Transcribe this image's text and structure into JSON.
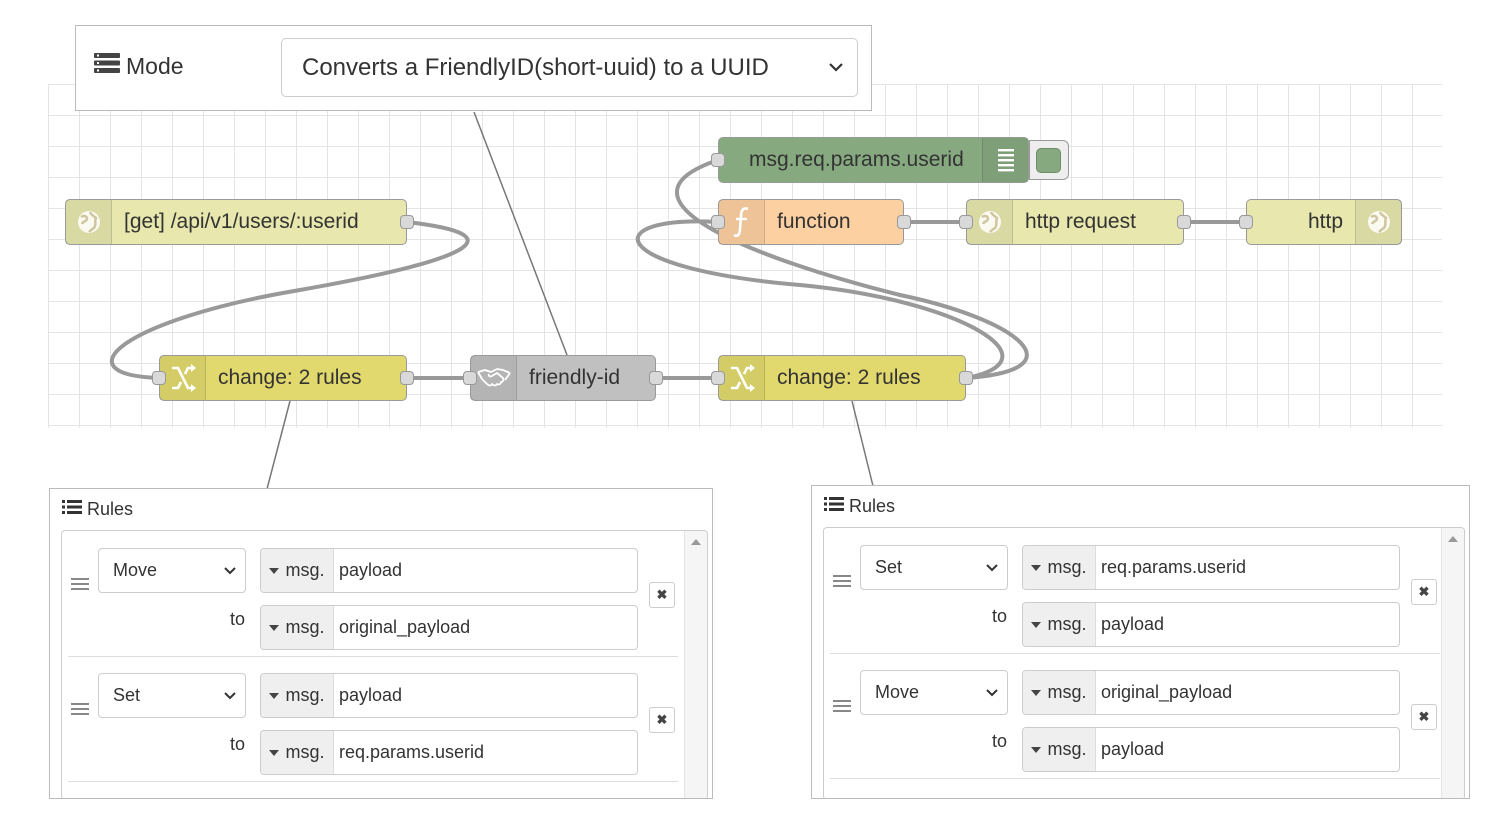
{
  "mode_panel": {
    "label": "Mode",
    "icon": "list-alt-icon",
    "selected": "Converts a FriendlyID(short-uuid) to a UUID"
  },
  "nodes": {
    "http_in": "[get] /api/v1/users/:userid",
    "debug": "msg.req.params.userid",
    "function": "function",
    "http_request": "http request",
    "http_response": "http",
    "change_left": "change: 2 rules",
    "friendly_id": "friendly-id",
    "change_right": "change: 2 rules"
  },
  "colors": {
    "http": "#e7e7ae",
    "debug": "#87a980",
    "function": "#fdd0a2",
    "change": "#e2d96e",
    "friendly": "#c0c0c0"
  },
  "rules_left": {
    "title": "Rules",
    "rules": [
      {
        "action": "Move",
        "from_type": "msg.",
        "from": "payload",
        "to_label": "to",
        "to_type": "msg.",
        "to": "original_payload"
      },
      {
        "action": "Set",
        "from_type": "msg.",
        "from": "payload",
        "to_label": "to",
        "to_type": "msg.",
        "to": "req.params.userid"
      }
    ]
  },
  "rules_right": {
    "title": "Rules",
    "rules": [
      {
        "action": "Set",
        "from_type": "msg.",
        "from": "req.params.userid",
        "to_label": "to",
        "to_type": "msg.",
        "to": "payload"
      },
      {
        "action": "Move",
        "from_type": "msg.",
        "from": "original_payload",
        "to_label": "to",
        "to_type": "msg.",
        "to": "payload"
      }
    ]
  }
}
